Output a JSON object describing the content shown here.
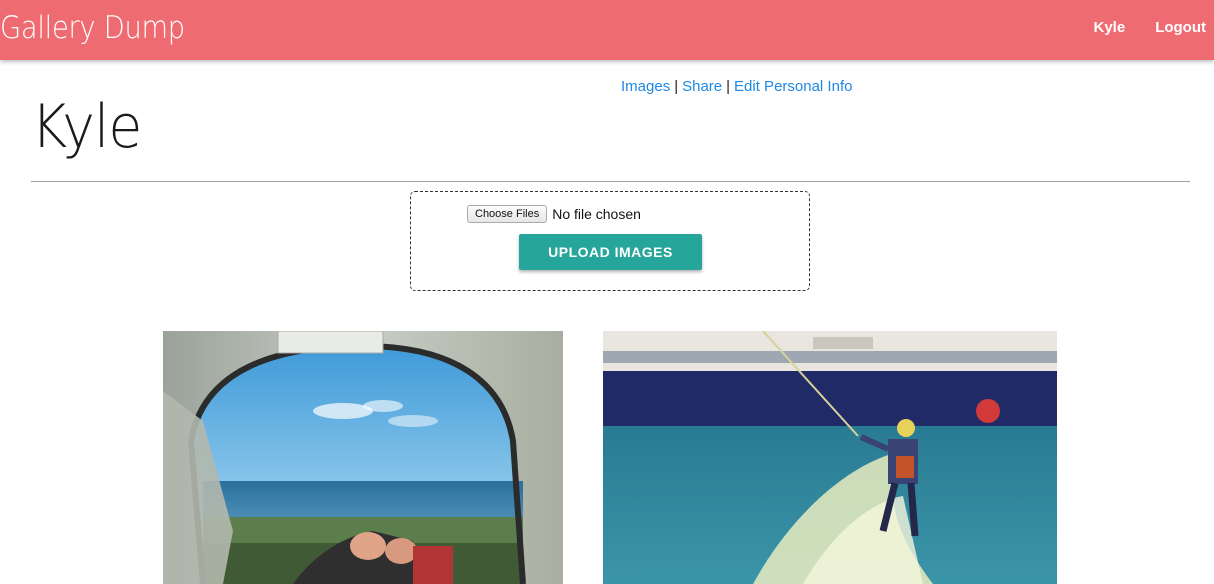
{
  "header": {
    "brand": "Gallery Dump",
    "user_link": "Kyle",
    "logout_link": "Logout"
  },
  "subnav": {
    "images": "Images",
    "share": "Share",
    "edit_info": "Edit Personal Info",
    "separator": "|"
  },
  "page": {
    "title": "Kyle"
  },
  "upload": {
    "choose_label": "Choose Files",
    "status": "No file chosen",
    "button_label": "UPLOAD IMAGES"
  },
  "gallery": {
    "images": [
      {
        "subject": "view from tent onto beach"
      },
      {
        "subject": "child wakeboarding"
      }
    ]
  },
  "colors": {
    "header": "#ef6b72",
    "link": "#1e88e5",
    "upload_button": "#26a69a"
  }
}
